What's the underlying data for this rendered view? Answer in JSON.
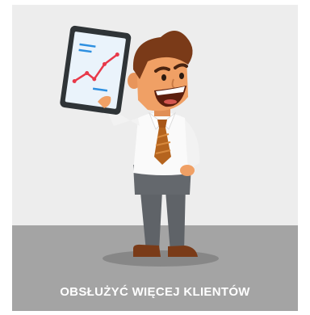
{
  "card": {
    "caption": "OBSŁUŻYĆ WIĘCEJ KLIENTÓW",
    "illustration": "businessman-holding-tablet-with-growth-chart"
  },
  "colors": {
    "wall": "#ededed",
    "floor": "#a4a4a4",
    "shirt": "#fafafa",
    "tie": "#b5641e",
    "trousers": "#5f6368",
    "skin": "#f0a065",
    "hair": "#7a3a18",
    "tablet_frame": "#2f3437",
    "chart_line": "#e8394a"
  }
}
